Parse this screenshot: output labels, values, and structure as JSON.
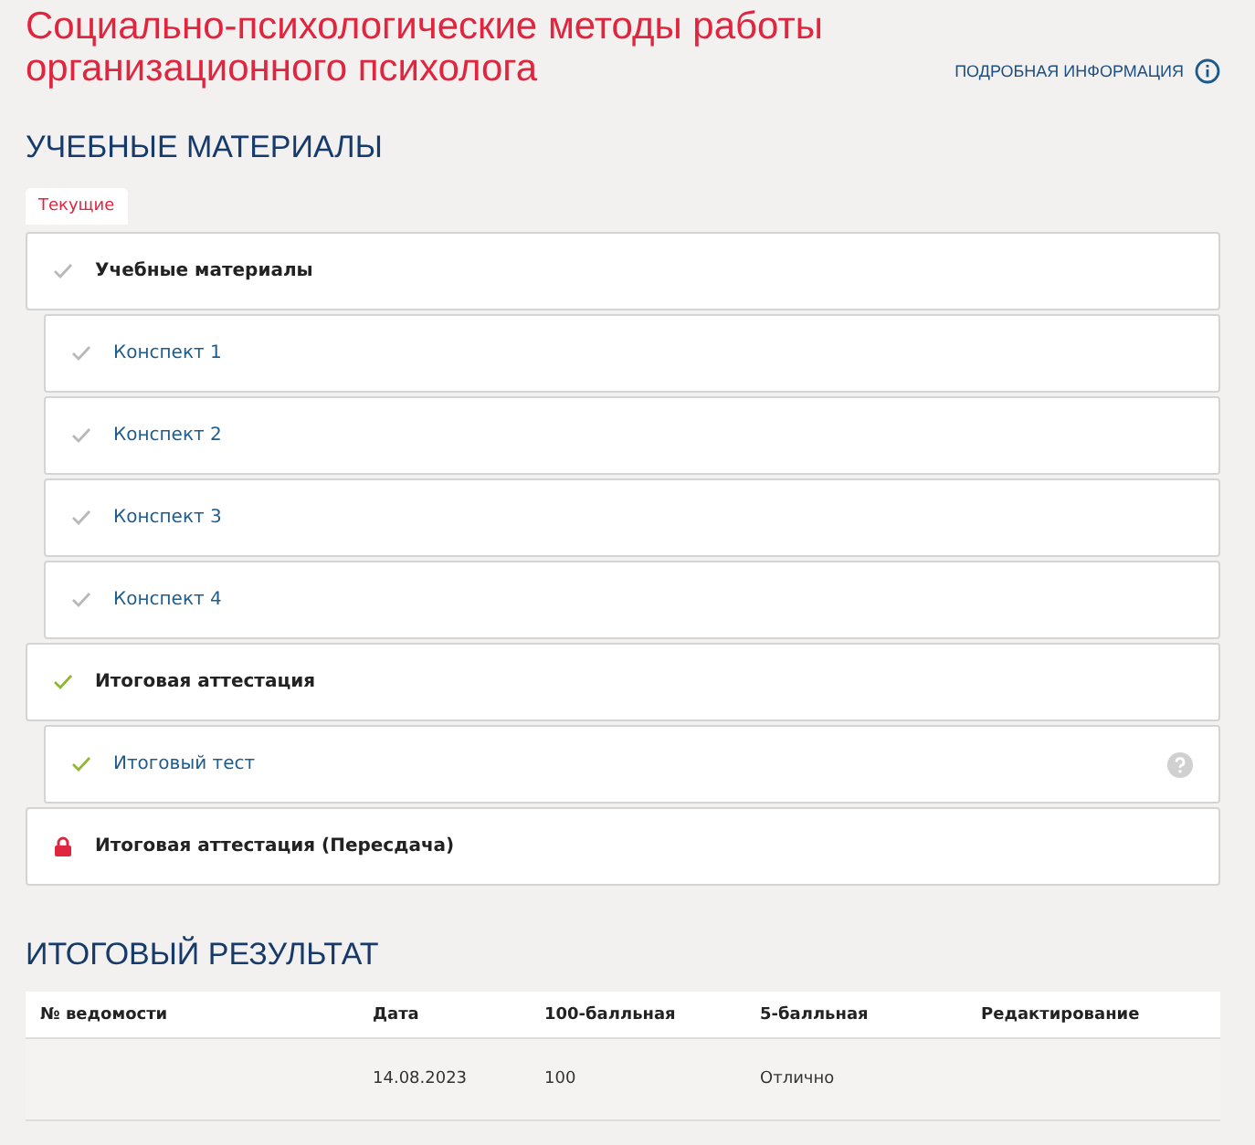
{
  "title": "Социально-психологические методы работы организационного психолога",
  "info_link": "ПОДРОБНАЯ ИНФОРМАЦИЯ",
  "materials": {
    "heading": "УЧЕБНЫЕ МАТЕРИАЛЫ",
    "tabs": [
      {
        "label": "Текущие",
        "selected": true
      }
    ],
    "sections": [
      {
        "label": "Учебные материалы",
        "kind": "viewed",
        "children": [
          {
            "label": "Конспект 1",
            "kind": "viewed",
            "help": false
          },
          {
            "label": "Конспект 2",
            "kind": "viewed",
            "help": false
          },
          {
            "label": "Конспект 3",
            "kind": "viewed",
            "help": false
          },
          {
            "label": "Конспект 4",
            "kind": "viewed",
            "help": false
          }
        ]
      },
      {
        "label": "Итоговая аттестация",
        "kind": "passed",
        "children": [
          {
            "label": "Итоговый тест",
            "kind": "passed",
            "help": true
          }
        ]
      },
      {
        "label": "Итоговая аттестация (Пересдача)",
        "kind": "locked"
      }
    ]
  },
  "result": {
    "heading": "ИТОГОВЫЙ РЕЗУЛЬТАТ",
    "columns": [
      "№ ведомости",
      "Дата",
      "100-балльная",
      "5-балльная",
      "Редактирование"
    ],
    "rows": [
      [
        "",
        "14.08.2023",
        "100",
        "Отлично",
        ""
      ]
    ]
  }
}
